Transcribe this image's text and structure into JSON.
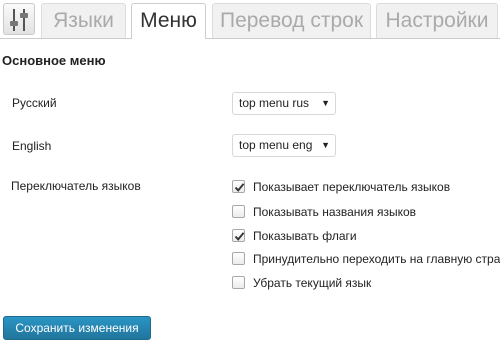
{
  "tabs": [
    {
      "label": "Языки",
      "active": false
    },
    {
      "label": "Меню",
      "active": true
    },
    {
      "label": "Перевод строк",
      "active": false
    },
    {
      "label": "Настройки",
      "active": false
    }
  ],
  "logo_icon": "equalizer-sliders-icon",
  "section_title": "Основное меню",
  "menus": [
    {
      "label": "Русский",
      "selected": "top menu rus"
    },
    {
      "label": "English",
      "selected": "top menu eng"
    }
  ],
  "switcher": {
    "label": "Переключатель языков",
    "options": [
      {
        "label": "Показывает переключатель языков",
        "checked": true
      },
      {
        "label": "Показывать названия языков",
        "checked": false
      },
      {
        "label": "Показывать флаги",
        "checked": true
      },
      {
        "label": "Принудительно переходить на главную стра",
        "checked": false
      },
      {
        "label": "Убрать текущий язык",
        "checked": false
      }
    ]
  },
  "save_button": "Сохранить изменения",
  "colors": {
    "primary_button": "#21759b",
    "tab_inactive_text": "#aaaaaa",
    "tab_active_text": "#333333"
  }
}
